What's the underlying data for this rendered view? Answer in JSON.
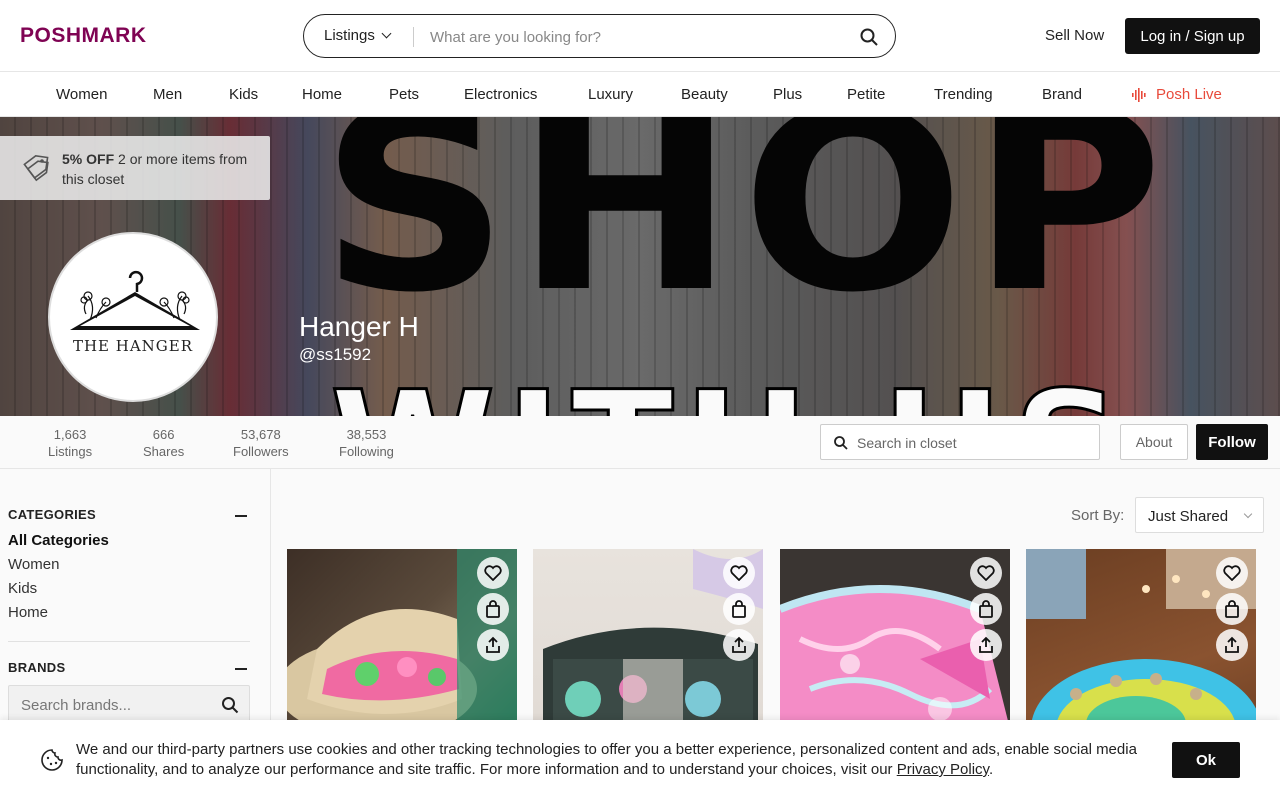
{
  "header": {
    "logo": "POSHMARK",
    "search_scope": "Listings",
    "search_placeholder": "What are you looking for?",
    "sell_now": "Sell Now",
    "login": "Log in / Sign up"
  },
  "nav": {
    "items": [
      "Women",
      "Men",
      "Kids",
      "Home",
      "Pets",
      "Electronics",
      "Luxury",
      "Beauty",
      "Plus",
      "Petite",
      "Trending",
      "Brand"
    ],
    "live": "Posh Live",
    "live_color": "#e84a3b"
  },
  "banner": {
    "promo_bold": "5% OFF",
    "promo_rest": " 2 or more items from this closet",
    "avatar_text": "THE HANGER",
    "name": "Hanger H",
    "handle": "@ss1592"
  },
  "stats": [
    {
      "value": "1,663",
      "label": "Listings"
    },
    {
      "value": "666",
      "label": "Shares"
    },
    {
      "value": "53,678",
      "label": "Followers"
    },
    {
      "value": "38,553",
      "label": "Following"
    }
  ],
  "closet_search_placeholder": "Search in closet",
  "about": "About",
  "follow": "Follow",
  "sidebar": {
    "categories_title": "CATEGORIES",
    "categories": [
      "All Categories",
      "Women",
      "Kids",
      "Home"
    ],
    "brands_title": "BRANDS",
    "brands_placeholder": "Search brands..."
  },
  "sort": {
    "label": "Sort By:",
    "value": "Just Shared"
  },
  "cookie": {
    "text": "We and our third-party partners use cookies and other tracking technologies to offer you a better experience, personalized content and ads, enable social media functionality, and to analyze our performance and site traffic. For more information and to understand your choices, visit our ",
    "link": "Privacy Policy",
    "end": ".",
    "ok": "Ok"
  },
  "colors": {
    "brand": "#7f0353",
    "dark": "#111111"
  }
}
